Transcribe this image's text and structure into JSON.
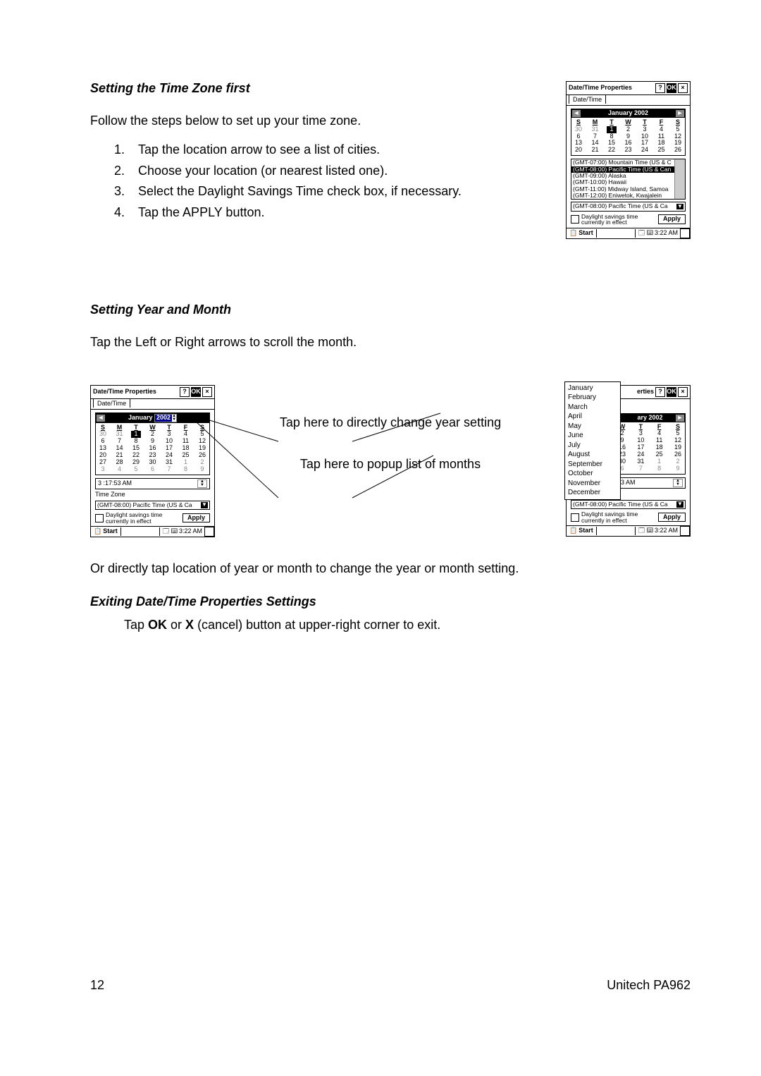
{
  "headings": {
    "h1": "Setting the Time Zone first",
    "h2": "Setting Year and Month",
    "h3": "Exiting Date/Time Properties Settings"
  },
  "intro1": "Follow the steps below to set up your time zone.",
  "steps": {
    "s1": "Tap the location arrow to see a list of cities.",
    "s2": "Choose your location (or nearest listed one).",
    "s3": "Select the Daylight Savings Time check box, if  necessary.",
    "s4": "Tap the APPLY button."
  },
  "yearmonth_intro": "Tap the Left or Right arrows to scroll the month.",
  "annot": {
    "a1": "Tap here to directly change year setting",
    "a2": "Tap here to popup list of months"
  },
  "body2": "Or directly tap location of year or month to change the year or month setting.",
  "exit_body_pre": "Tap ",
  "exit_body_ok": "OK",
  "exit_body_mid": " or ",
  "exit_body_x": "X",
  "exit_body_post": " (cancel) button at upper-right corner to exit.",
  "footer": {
    "page": "12",
    "product": "Unitech PA962"
  },
  "pda": {
    "title": "Date/Time Properties",
    "tab": "Date/Time",
    "ok": "OK",
    "q": "?",
    "x": "×",
    "month_label": "January 2002",
    "month_label_short": "ary 2002",
    "dow": [
      "S",
      "M",
      "T",
      "W",
      "T",
      "F",
      "S"
    ],
    "weeks": [
      [
        "30",
        "31",
        "1",
        "2",
        "3",
        "4",
        "5"
      ],
      [
        "6",
        "7",
        "8",
        "9",
        "10",
        "11",
        "12"
      ],
      [
        "13",
        "14",
        "15",
        "16",
        "17",
        "18",
        "19"
      ],
      [
        "20",
        "21",
        "22",
        "23",
        "24",
        "25",
        "26"
      ],
      [
        "27",
        "28",
        "29",
        "30",
        "31",
        "1",
        "2"
      ],
      [
        "3",
        "4",
        "5",
        "6",
        "7",
        "8",
        "9"
      ]
    ],
    "tz_items": [
      "(GMT-07:00) Mountain Time (US & C",
      "(GMT-08:00) Pacific Time (US & Can",
      "(GMT-09:00) Alaska",
      "(GMT-10:00) Hawaii",
      "(GMT-11:00) Midway Island, Samoa",
      "(GMT-12:00) Eniwetok, Kwajalein"
    ],
    "tz_selected": "(GMT-08:00) Pacific Time (US & Ca",
    "dls": "Daylight savings time currently in effect",
    "apply": "Apply",
    "start": "Start",
    "tray_time": "3:22 AM",
    "time1": "3 :17:53 AM",
    "time2": "53 AM",
    "timezone_label": "Time Zone",
    "year": "2002",
    "month_january": "January",
    "properties_short": "erties"
  },
  "months": [
    "January",
    "February",
    "March",
    "April",
    "May",
    "June",
    "July",
    "August",
    "September",
    "October",
    "November",
    "December"
  ]
}
